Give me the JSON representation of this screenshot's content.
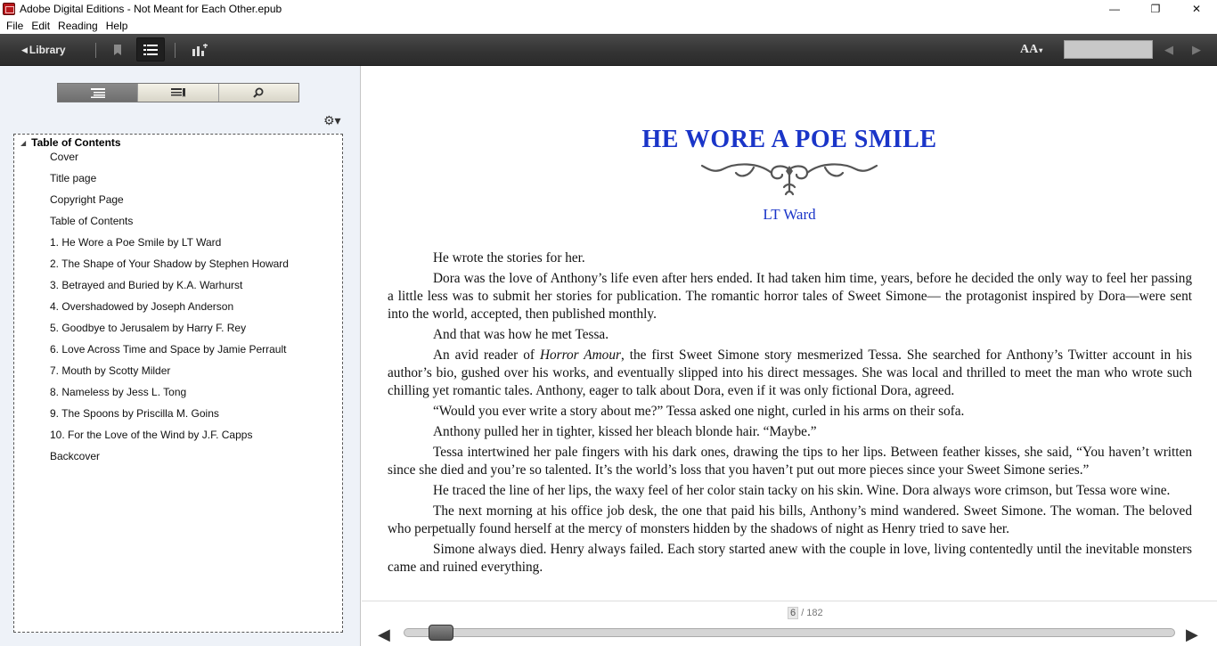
{
  "window": {
    "title": "Adobe Digital Editions - Not Meant for Each Other.epub",
    "controls": {
      "minimize": "—",
      "restore": "❐",
      "close": "✕"
    }
  },
  "menu": {
    "items": [
      "File",
      "Edit",
      "Reading",
      "Help"
    ]
  },
  "toolbar": {
    "library_label": "Library",
    "library_arrow": "◀",
    "bookmark_icon": "bookmark-icon",
    "toc_icon": "list-icon",
    "add_chart_icon": "add-chart-icon",
    "font_size_label": "AA",
    "font_size_caret": "▾",
    "prev_arrow": "◀",
    "next_arrow": "▶"
  },
  "sidebar": {
    "tab_icons": [
      "toc-icon",
      "bookmarks-icon",
      "search-icon"
    ],
    "gear_label": "⚙▾",
    "toc_header": "Table of Contents",
    "toc_expander": "◢",
    "toc_items": [
      "Cover",
      "Title page",
      "Copyright Page",
      "Table of Contents",
      "1. He Wore a Poe Smile by LT Ward",
      "2. The Shape of Your Shadow by Stephen Howard",
      "3. Betrayed and Buried by K.A. Warhurst",
      "4. Overshadowed by Joseph Anderson",
      "5. Goodbye to Jerusalem by Harry F. Rey",
      "6. Love Across Time and Space by Jamie Perrault",
      "7. Mouth by Scotty Milder",
      "8. Nameless by Jess L. Tong",
      "9. The Spoons by Priscilla M. Goins",
      "10. For the Love of the Wind by J.F. Capps",
      "Backcover"
    ]
  },
  "reader": {
    "chapter_title": "HE WORE A POE SMILE",
    "author": "LT Ward",
    "paragraphs": [
      {
        "text": "He wrote the stories for her."
      },
      {
        "text": "Dora was the love of Anthony’s life even after hers ended. It had taken him time, years, before he decided the only way to feel her passing a little less was to submit her stories for publication. The romantic horror tales of Sweet Simone— the protagonist inspired by Dora—were sent into the world, accepted, then published monthly."
      },
      {
        "text": "And that was how he met Tessa."
      },
      {
        "before": "An avid reader of ",
        "italic": "Horror Amour",
        "after": ", the first Sweet Simone story mesmerized Tessa. She searched for Anthony’s Twitter account in his author’s bio, gushed over his works, and eventually slipped into his direct messages. She was local and thrilled to meet the man who wrote such chilling yet romantic tales. Anthony, eager to talk about Dora, even if it was only fictional Dora, agreed."
      },
      {
        "text": "“Would you ever write a story about me?” Tessa asked one night, curled in his arms on their sofa."
      },
      {
        "text": "Anthony pulled her in tighter, kissed her bleach blonde hair. “Maybe.”"
      },
      {
        "text": "Tessa intertwined her pale fingers with his dark ones, drawing the tips to her lips. Between feather kisses, she said, “You haven’t written since she died and you’re so talented. It’s the world’s loss that you haven’t put out more pieces since your Sweet Simone series.”"
      },
      {
        "text": "He traced the line of her lips, the waxy feel of her color stain tacky on his skin. Wine. Dora always wore crimson, but Tessa wore wine."
      },
      {
        "text": "The next morning at his office job desk, the one that paid his bills, Anthony’s mind wandered. Sweet Simone. The woman. The beloved who perpetually found herself at the mercy of monsters hidden by the shadows of night as Henry tried to save her."
      },
      {
        "text": "Simone always died. Henry always failed. Each story started anew with the couple in love, living contentedly until the inevitable monsters came and ruined everything."
      }
    ],
    "title_color": "#1a35c8"
  },
  "pager": {
    "current_page": "6",
    "total_label": "/ 182",
    "progress_fraction": 0.033,
    "prev_arrow": "◀",
    "next_arrow": "▶"
  }
}
